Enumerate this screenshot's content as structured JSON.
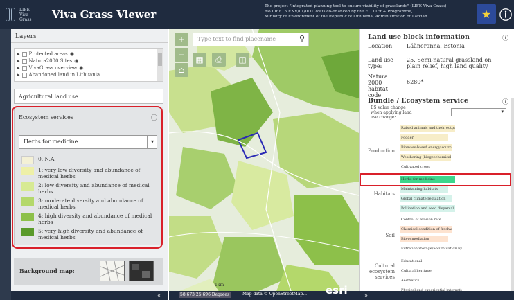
{
  "header": {
    "logo_lines": [
      "LIFE",
      "Viva",
      "Grass"
    ],
    "app_title": "Viva Grass Viewer",
    "project_lines": [
      "The project \"Integrated planning tool to ensure viability of grasslands\" (LIFE Viva Grass)",
      "No LIFE13 ENV/LT/000189 is co-financed by the EU LIFE+ Programme,",
      "Ministry of Environment of the Republic of Lithuania, Administration of Latvian..."
    ]
  },
  "layers": {
    "title": "Layers",
    "items": [
      {
        "label": "Protected areas"
      },
      {
        "label": "Natura2000 Sites"
      },
      {
        "label": "VivaGrass overview"
      },
      {
        "label": "Abandoned land in Lithuania"
      }
    ],
    "selected_group": "Agricultural land use"
  },
  "ecosystem": {
    "title": "Ecosystem services",
    "selected": "Herbs for medicine",
    "legend": [
      {
        "label": "0. N.A.",
        "color": "#f4f1d6"
      },
      {
        "label": "1: very low diversity and abundance of medical herbs",
        "color": "#eef0a8"
      },
      {
        "label": "2: low diversity and abundance of medical herbs",
        "color": "#d7ea93"
      },
      {
        "label": "3: moderate diversity and abundance of medical herbs",
        "color": "#b4d86b"
      },
      {
        "label": "4: high diversity and abundance of medical herbs",
        "color": "#8dc04a"
      },
      {
        "label": "5: very high diversity and abundance of medical herbs",
        "color": "#5a9a2a"
      }
    ]
  },
  "background_map": {
    "label": "Background map:"
  },
  "map": {
    "search_placeholder": "Type text to find placename",
    "coords": "58.673 25.696 Degrees",
    "credit": "Map data © OpenStreetMap...",
    "scale": "1km",
    "brand": "esri"
  },
  "info": {
    "title": "Land use block information",
    "location_label": "Location:",
    "location_value": "Lääneranna, Estonia",
    "type_label": "Land use type:",
    "type_value": "25. Semi-natural grassland on plain relief, high land quality",
    "habitat_label": "Natura 2000 habitat code:",
    "habitat_value": "6280*"
  },
  "bundle": {
    "title": "Bundle / Ecosystem service",
    "es_label": "ES value change when applying land use change:",
    "categories": [
      "Production",
      "Habitats",
      "Soil",
      "Cultural ecosystem services"
    ],
    "services": [
      {
        "label": "Raised animals and their outputs",
        "color": "#f7edc8"
      },
      {
        "label": "Fodder",
        "color": "#f7edc8"
      },
      {
        "label": "Biomass-based energy sources",
        "color": "#f7edc8"
      },
      {
        "label": "Weathering (biogeochemical fertility)",
        "color": "#f7edc8"
      },
      {
        "label": "Cultivated crops",
        "color": "#ffffff"
      },
      {
        "label": "Herbs for medicine",
        "color": "#3dd68c"
      },
      {
        "label": "Maintaining habitats",
        "color": "#d5f2ea"
      },
      {
        "label": "Global climate regulation",
        "color": "#d5f2ea"
      },
      {
        "label": "Pollination and seed dispersal",
        "color": "#d5f2ea"
      },
      {
        "label": "Control of erosion rates",
        "color": "#ffffff"
      },
      {
        "label": "Chemical condition of freshwaters",
        "color": "#fde3d0"
      },
      {
        "label": "Bio-remediation",
        "color": "#fde3d0"
      },
      {
        "label": "Filtration/storage/accumulation by ecosystems",
        "color": "#ffffff"
      },
      {
        "label": "Educational",
        "color": "#ffffff"
      },
      {
        "label": "Cultural heritage",
        "color": "#ffffff"
      },
      {
        "label": "Aesthetics",
        "color": "#ffffff"
      },
      {
        "label": "Physical and experiential interactions",
        "color": "#ffffff"
      }
    ]
  },
  "colors": {
    "dark": "#1f2b3f",
    "highlight": "#d9202a"
  }
}
